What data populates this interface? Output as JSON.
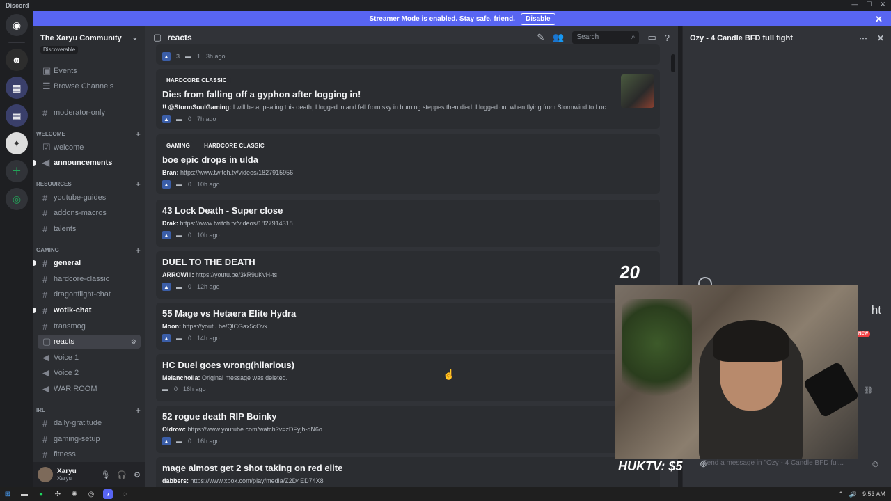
{
  "app": {
    "title": "Discord"
  },
  "banner": {
    "text": "Streamer Mode is enabled. Stay safe, friend.",
    "button": "Disable"
  },
  "server": {
    "name": "The Xaryu Community",
    "badge": "Discoverable"
  },
  "channels": {
    "events": "Events",
    "browse": "Browse Channels",
    "moderator": "moderator-only",
    "cat_welcome": "WELCOME",
    "welcome": "welcome",
    "announcements": "announcements",
    "cat_resources": "RESOURCES",
    "youtube": "youtube-guides",
    "addons": "addons-macros",
    "talents": "talents",
    "cat_gaming": "GAMING",
    "general": "general",
    "hardcore": "hardcore-classic",
    "dragonflight": "dragonflight-chat",
    "wotlk": "wotlk-chat",
    "transmog": "transmog",
    "reacts": "reacts",
    "voice1": "Voice 1",
    "voice2": "Voice 2",
    "war": "WAR ROOM",
    "cat_irl": "IRL",
    "gratitude": "daily-gratitude",
    "setup": "gaming-setup",
    "fitness": "fitness"
  },
  "user": {
    "name": "Xaryu",
    "sub": "Xaryu"
  },
  "header": {
    "channel": "reacts",
    "search": "Search"
  },
  "posts": [
    {
      "top": {
        "up": "3",
        "comments": "1",
        "time": "3h ago"
      }
    },
    {
      "tags": [
        "HARDCORE CLASSIC"
      ],
      "title": "Dies from falling off a gyphon after logging in!",
      "author": "!! @StormSoulGaming:",
      "text": "I will be appealing this death; I logged in and fell from sky in burning steppes then died. I logged out when flying from Stormwind to Loch ...",
      "comments": "0",
      "time": "7h ago"
    },
    {
      "tags": [
        "GAMING",
        "HARDCORE CLASSIC"
      ],
      "title": "boe epic drops in ulda",
      "author": "Bran:",
      "text": "https://www.twitch.tv/videos/1827915956",
      "comments": "0",
      "time": "10h ago"
    },
    {
      "title": "43 Lock Death - Super close",
      "author": "Drak:",
      "text": "https://www.twitch.tv/videos/1827914318",
      "comments": "0",
      "time": "10h ago"
    },
    {
      "title": "DUEL TO THE DEATH",
      "author": "ARROWlii:",
      "text": "https://youtu.be/3kR9uKvH-ts",
      "comments": "0",
      "time": "12h ago"
    },
    {
      "title": "55 Mage vs Hetaera Elite Hydra",
      "author": "Moon:",
      "text": "https://youtu.be/QlCGax5cOvk",
      "comments": "0",
      "time": "14h ago"
    },
    {
      "title": "HC Duel goes wrong(hilarious)",
      "author": "Melancholia:",
      "text": "Original message was deleted.",
      "comments": "0",
      "time": "16h ago"
    },
    {
      "title": "52 rogue death RIP Boinky",
      "author": "Oldrow:",
      "text": "https://www.youtube.com/watch?v=zDFyjh-dN6o",
      "comments": "0",
      "time": "16h ago"
    },
    {
      "title": "mage almost get 2 shot taking on red elite",
      "author": "dabbers:",
      "text": "https://www.xbox.com/play/media/Z2D4ED74X8"
    }
  ],
  "thread": {
    "title": "Ozy - 4 Candle BFD full fight",
    "input": "Send a message in \"Ozy - 4 Candle BFD ful...",
    "ht": "ht",
    "new": "NEW"
  },
  "overlay": {
    "count": "20",
    "donation": "HUKTV: $5"
  },
  "taskbar": {
    "time": "9:53 AM"
  }
}
